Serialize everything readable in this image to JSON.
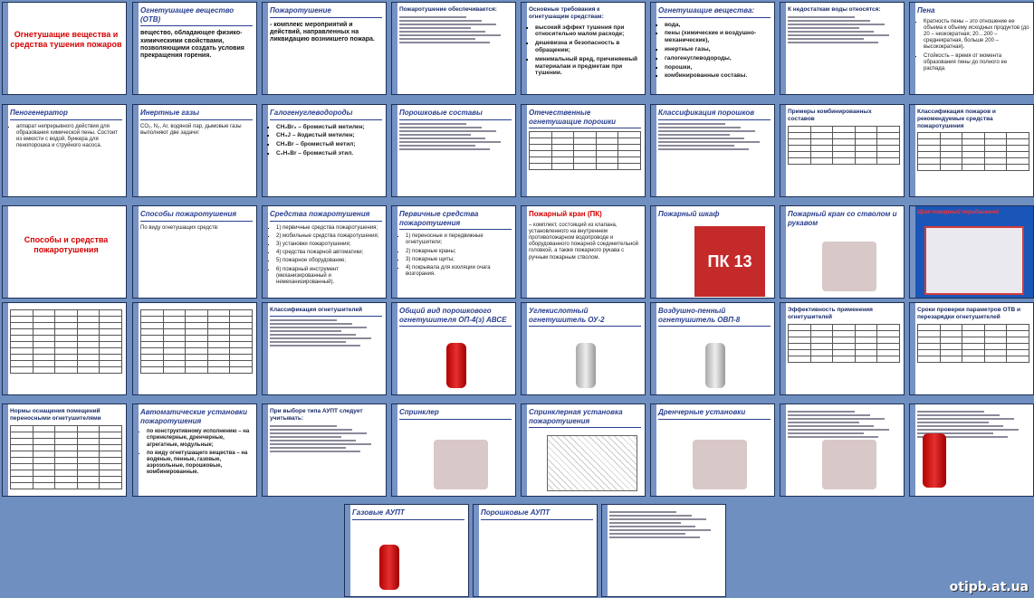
{
  "slides": [
    {
      "title": "Огнетушащие вещества и средства тушения пожаров",
      "body": ""
    },
    {
      "title": "Огнетушащее вещество (ОТВ)",
      "body": "вещество, обладающее физико-химическими свойствами, позволяющими создать условия прекращения горения."
    },
    {
      "title": "Пожаротушение",
      "body": "- комплекс мероприятий и действий, направленных на ликвидацию возникшего пожара."
    },
    {
      "title": "Пожаротушение обеспечивается:",
      "body": ""
    },
    {
      "title": "Основные требования к огнетушащим средствам:",
      "items": [
        "высокий эффект тушения при относительно малом расходе;",
        "дешевизна и безопасность в обращении;",
        "минимальный вред, причиняемый материалам и предметам при тушении."
      ]
    },
    {
      "title": "Огнетушащие вещества:",
      "items": [
        "вода,",
        "пены (химические и воздушно-механические),",
        "инертные газы,",
        "галогенуглеводороды,",
        "порошки,",
        "комбинированные составы."
      ]
    },
    {
      "title": "К недостаткам воды относятся:",
      "body": ""
    },
    {
      "title": "Пена",
      "items": [
        "Кратность пены – это отношение ее объема к объему исходных продуктов (до 20 – низкократная; 20…200 – среднекратная, больше 200 – высокократная).",
        "Стойкость – время от момента образования пены до полного ее распада."
      ]
    },
    {
      "title": "Пеногенератор",
      "items": [
        "аппарат непрерывного действия для образования химической пены. Состоит из емкости с водой, бункера для пенопорошка и струйного насоса."
      ]
    },
    {
      "title": "Инертные газы",
      "body": "CO₂, N₂, Ar, водяной пар, дымовые газы выполняют две задачи:"
    },
    {
      "title": "Галогенуглеводороды",
      "items": [
        "CH₂Br₂ – бромистый метилен;",
        "CH₃J – йодистый метилен;",
        "CH₃Br – бромистый метил;",
        "C₂H₅Br – бромистый этил."
      ]
    },
    {
      "title": "Порошковые составы",
      "body": ""
    },
    {
      "title": "Отечественные огнетушащие порошки",
      "body": ""
    },
    {
      "title": "Классификация порошков",
      "body": ""
    },
    {
      "title": "Примеры комбинированных составов",
      "body": ""
    },
    {
      "title": "Классификация пожаров и рекомендуемые средства пожаротушения",
      "body": ""
    },
    {
      "title": "Способы и средства пожаротушения",
      "body": ""
    },
    {
      "title": "Способы пожаротушения",
      "body": "По виду огнетушащих средств:"
    },
    {
      "title": "Средства пожаротушения",
      "items": [
        "1) первичные средства пожаротушения;",
        "2) мобильные средства пожаротушения;",
        "3) установки пожаротушения;",
        "4) средства пожарной автоматики;",
        "5) пожарное оборудование;",
        "6) пожарный инструмент (механизированный и немеханизированный)."
      ]
    },
    {
      "title": "Первичные средства пожаротушения",
      "items": [
        "1) переносные и передвижные огнетушители;",
        "2) пожарные краны;",
        "3) пожарные щиты;",
        "4) покрывала для изоляции очага возгорания."
      ]
    },
    {
      "title": "Пожарный кран (ПК)",
      "body": "– комплект, состоящий из клапана, установленного на внутреннем противопожарном водопроводе и оборудованного пожарной соединительной головкой, а также пожарного рукава с ручным пожарным стволом."
    },
    {
      "title": "Пожарный шкаф",
      "body": "ПК 13"
    },
    {
      "title": "Пожарный кран со стволом и рукавом",
      "body": ""
    },
    {
      "title": "Щит пожарный передвижной",
      "body": ""
    },
    {
      "title": "",
      "body": ""
    },
    {
      "title": "",
      "body": ""
    },
    {
      "title": "Классификация огнетушителей",
      "body": ""
    },
    {
      "title": "Общий вид порошкового огнетушителя ОП-4(з) АВСЕ",
      "body": ""
    },
    {
      "title": "Углекислотный огнетушитель ОУ-2",
      "body": ""
    },
    {
      "title": "Воздушно-пенный огнетушитель ОВП-8",
      "body": ""
    },
    {
      "title": "Эффективность применения огнетушителей",
      "body": ""
    },
    {
      "title": "Сроки проверки параметров ОТВ и перезарядки огнетушителей",
      "body": ""
    },
    {
      "title": "Нормы оснащения помещений переносными огнетушителями",
      "body": ""
    },
    {
      "title": "Автоматические установки пожаротушения",
      "items": [
        "по конструктивному исполнению – на спринклерные, дренчерные, агрегатные, модульные;",
        "по виду огнетушащего вещества – на водяные, пенные, газовые, аэрозольные, порошковые, комбинированные."
      ]
    },
    {
      "title": "При выборе типа АУПТ следует учитывать:",
      "body": ""
    },
    {
      "title": "Спринклер",
      "body": ""
    },
    {
      "title": "Спринклерная установка пожаротушения",
      "body": ""
    },
    {
      "title": "Дренчерные установки",
      "body": ""
    },
    {
      "title": "",
      "body": ""
    },
    {
      "title": "",
      "body": ""
    },
    {
      "title": "Газовые АУПТ",
      "body": ""
    },
    {
      "title": "Порошковые АУПТ",
      "body": ""
    },
    {
      "title": "",
      "body": ""
    }
  ],
  "watermark": "otipb.at.ua",
  "colors": {
    "background": "#6f8fc0",
    "title_blue": "#2a3f8f",
    "title_red": "#d40000",
    "accent_blue": "#1a56b8"
  }
}
